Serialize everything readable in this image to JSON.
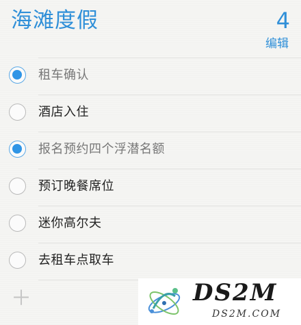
{
  "header": {
    "title": "海滩度假",
    "count": "4",
    "edit_label": "编辑"
  },
  "items": [
    {
      "label": "租车确认",
      "completed": true
    },
    {
      "label": "酒店入住",
      "completed": false
    },
    {
      "label": "报名预约四个浮潜名额",
      "completed": true
    },
    {
      "label": "预订晚餐席位",
      "completed": false
    },
    {
      "label": "迷你高尔夫",
      "completed": false
    },
    {
      "label": "去租车点取车",
      "completed": false
    }
  ],
  "add_icon": "plus-icon",
  "watermark": {
    "title": "DS2M",
    "subtitle": "DS2M.COM"
  },
  "colors": {
    "accent": "#2f8fd8",
    "check_fill": "#2f95e6"
  }
}
